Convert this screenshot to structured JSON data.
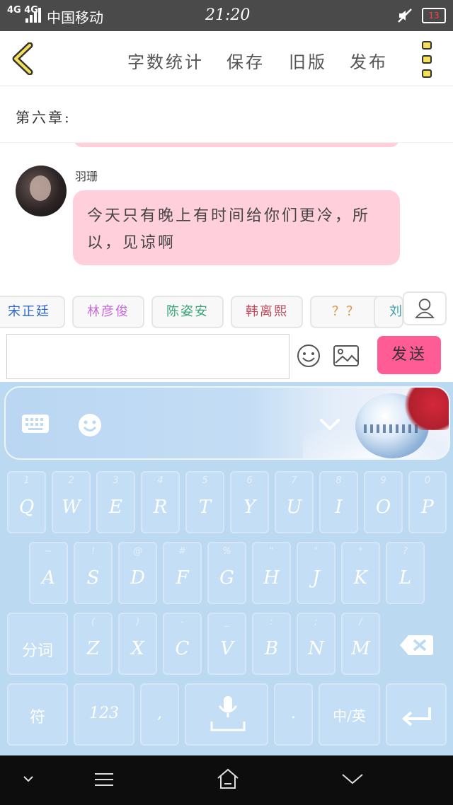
{
  "status_bar": {
    "signal_label": "4G 4G",
    "carrier": "中国移动",
    "time": "21:20",
    "battery": "13"
  },
  "toolbar": {
    "word_count": "字数统计",
    "save": "保存",
    "old_version": "旧版",
    "publish": "发布"
  },
  "chapter": {
    "title": "第六章:"
  },
  "chat": {
    "sender_name": "羽珊",
    "message": "今天只有晚上有时间给你们更冷，所以，见谅啊"
  },
  "characters": [
    {
      "label": "宋正廷",
      "color": "#2f66c8"
    },
    {
      "label": "林彦俊",
      "color": "#c66ad8"
    },
    {
      "label": "陈姿安",
      "color": "#3aa47b"
    },
    {
      "label": "韩离熙",
      "color": "#c0475a"
    },
    {
      "label": "？？",
      "color": "#e09040"
    },
    {
      "label": "刘",
      "color": "#3aa0a8"
    }
  ],
  "composer": {
    "input_value": "",
    "send_label": "发送",
    "send_color": "#ff5c95"
  },
  "keyboard": {
    "row1": [
      {
        "main": "Q",
        "sub": "1"
      },
      {
        "main": "W",
        "sub": "2"
      },
      {
        "main": "E",
        "sub": "3"
      },
      {
        "main": "R",
        "sub": "4"
      },
      {
        "main": "T",
        "sub": "5"
      },
      {
        "main": "Y",
        "sub": "6"
      },
      {
        "main": "U",
        "sub": "7"
      },
      {
        "main": "I",
        "sub": "8"
      },
      {
        "main": "O",
        "sub": "9"
      },
      {
        "main": "P",
        "sub": "0"
      }
    ],
    "row2": [
      {
        "main": "A",
        "sub": "~"
      },
      {
        "main": "S",
        "sub": "!"
      },
      {
        "main": "D",
        "sub": "@"
      },
      {
        "main": "F",
        "sub": "#"
      },
      {
        "main": "G",
        "sub": "%"
      },
      {
        "main": "H",
        "sub": "\""
      },
      {
        "main": "J",
        "sub": "\""
      },
      {
        "main": "K",
        "sub": "*"
      },
      {
        "main": "L",
        "sub": "?"
      }
    ],
    "row3": [
      {
        "main": "分词",
        "sub": ""
      },
      {
        "main": "Z",
        "sub": "("
      },
      {
        "main": "X",
        "sub": ")"
      },
      {
        "main": "C",
        "sub": "-"
      },
      {
        "main": "V",
        "sub": "_"
      },
      {
        "main": "B",
        "sub": ":"
      },
      {
        "main": "N",
        "sub": ";"
      },
      {
        "main": "M",
        "sub": "/"
      }
    ],
    "row4": {
      "symbols": "符",
      "numbers": "123",
      "comma": ",",
      "period": ".",
      "lang": "中/英"
    }
  }
}
